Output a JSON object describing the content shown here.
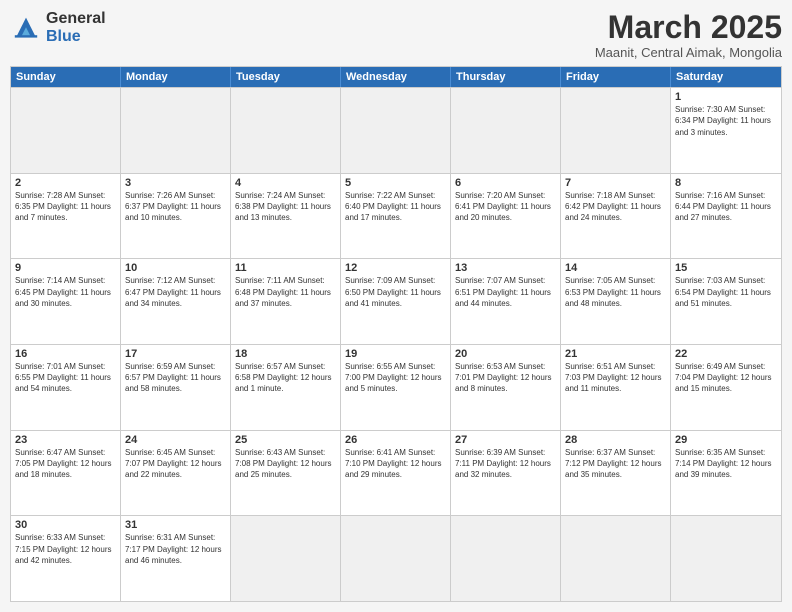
{
  "header": {
    "logo_general": "General",
    "logo_blue": "Blue",
    "month_title": "March 2025",
    "subtitle": "Maanit, Central Aimak, Mongolia"
  },
  "days_of_week": [
    "Sunday",
    "Monday",
    "Tuesday",
    "Wednesday",
    "Thursday",
    "Friday",
    "Saturday"
  ],
  "rows": [
    [
      {
        "day": "",
        "info": "",
        "empty": true
      },
      {
        "day": "",
        "info": "",
        "empty": true
      },
      {
        "day": "",
        "info": "",
        "empty": true
      },
      {
        "day": "",
        "info": "",
        "empty": true
      },
      {
        "day": "",
        "info": "",
        "empty": true
      },
      {
        "day": "",
        "info": "",
        "empty": true
      },
      {
        "day": "1",
        "info": "Sunrise: 7:30 AM\nSunset: 6:34 PM\nDaylight: 11 hours\nand 3 minutes.",
        "empty": false
      }
    ],
    [
      {
        "day": "2",
        "info": "Sunrise: 7:28 AM\nSunset: 6:35 PM\nDaylight: 11 hours\nand 7 minutes.",
        "empty": false
      },
      {
        "day": "3",
        "info": "Sunrise: 7:26 AM\nSunset: 6:37 PM\nDaylight: 11 hours\nand 10 minutes.",
        "empty": false
      },
      {
        "day": "4",
        "info": "Sunrise: 7:24 AM\nSunset: 6:38 PM\nDaylight: 11 hours\nand 13 minutes.",
        "empty": false
      },
      {
        "day": "5",
        "info": "Sunrise: 7:22 AM\nSunset: 6:40 PM\nDaylight: 11 hours\nand 17 minutes.",
        "empty": false
      },
      {
        "day": "6",
        "info": "Sunrise: 7:20 AM\nSunset: 6:41 PM\nDaylight: 11 hours\nand 20 minutes.",
        "empty": false
      },
      {
        "day": "7",
        "info": "Sunrise: 7:18 AM\nSunset: 6:42 PM\nDaylight: 11 hours\nand 24 minutes.",
        "empty": false
      },
      {
        "day": "8",
        "info": "Sunrise: 7:16 AM\nSunset: 6:44 PM\nDaylight: 11 hours\nand 27 minutes.",
        "empty": false
      }
    ],
    [
      {
        "day": "9",
        "info": "Sunrise: 7:14 AM\nSunset: 6:45 PM\nDaylight: 11 hours\nand 30 minutes.",
        "empty": false
      },
      {
        "day": "10",
        "info": "Sunrise: 7:12 AM\nSunset: 6:47 PM\nDaylight: 11 hours\nand 34 minutes.",
        "empty": false
      },
      {
        "day": "11",
        "info": "Sunrise: 7:11 AM\nSunset: 6:48 PM\nDaylight: 11 hours\nand 37 minutes.",
        "empty": false
      },
      {
        "day": "12",
        "info": "Sunrise: 7:09 AM\nSunset: 6:50 PM\nDaylight: 11 hours\nand 41 minutes.",
        "empty": false
      },
      {
        "day": "13",
        "info": "Sunrise: 7:07 AM\nSunset: 6:51 PM\nDaylight: 11 hours\nand 44 minutes.",
        "empty": false
      },
      {
        "day": "14",
        "info": "Sunrise: 7:05 AM\nSunset: 6:53 PM\nDaylight: 11 hours\nand 48 minutes.",
        "empty": false
      },
      {
        "day": "15",
        "info": "Sunrise: 7:03 AM\nSunset: 6:54 PM\nDaylight: 11 hours\nand 51 minutes.",
        "empty": false
      }
    ],
    [
      {
        "day": "16",
        "info": "Sunrise: 7:01 AM\nSunset: 6:55 PM\nDaylight: 11 hours\nand 54 minutes.",
        "empty": false
      },
      {
        "day": "17",
        "info": "Sunrise: 6:59 AM\nSunset: 6:57 PM\nDaylight: 11 hours\nand 58 minutes.",
        "empty": false
      },
      {
        "day": "18",
        "info": "Sunrise: 6:57 AM\nSunset: 6:58 PM\nDaylight: 12 hours\nand 1 minute.",
        "empty": false
      },
      {
        "day": "19",
        "info": "Sunrise: 6:55 AM\nSunset: 7:00 PM\nDaylight: 12 hours\nand 5 minutes.",
        "empty": false
      },
      {
        "day": "20",
        "info": "Sunrise: 6:53 AM\nSunset: 7:01 PM\nDaylight: 12 hours\nand 8 minutes.",
        "empty": false
      },
      {
        "day": "21",
        "info": "Sunrise: 6:51 AM\nSunset: 7:03 PM\nDaylight: 12 hours\nand 11 minutes.",
        "empty": false
      },
      {
        "day": "22",
        "info": "Sunrise: 6:49 AM\nSunset: 7:04 PM\nDaylight: 12 hours\nand 15 minutes.",
        "empty": false
      }
    ],
    [
      {
        "day": "23",
        "info": "Sunrise: 6:47 AM\nSunset: 7:05 PM\nDaylight: 12 hours\nand 18 minutes.",
        "empty": false
      },
      {
        "day": "24",
        "info": "Sunrise: 6:45 AM\nSunset: 7:07 PM\nDaylight: 12 hours\nand 22 minutes.",
        "empty": false
      },
      {
        "day": "25",
        "info": "Sunrise: 6:43 AM\nSunset: 7:08 PM\nDaylight: 12 hours\nand 25 minutes.",
        "empty": false
      },
      {
        "day": "26",
        "info": "Sunrise: 6:41 AM\nSunset: 7:10 PM\nDaylight: 12 hours\nand 29 minutes.",
        "empty": false
      },
      {
        "day": "27",
        "info": "Sunrise: 6:39 AM\nSunset: 7:11 PM\nDaylight: 12 hours\nand 32 minutes.",
        "empty": false
      },
      {
        "day": "28",
        "info": "Sunrise: 6:37 AM\nSunset: 7:12 PM\nDaylight: 12 hours\nand 35 minutes.",
        "empty": false
      },
      {
        "day": "29",
        "info": "Sunrise: 6:35 AM\nSunset: 7:14 PM\nDaylight: 12 hours\nand 39 minutes.",
        "empty": false
      }
    ],
    [
      {
        "day": "30",
        "info": "Sunrise: 6:33 AM\nSunset: 7:15 PM\nDaylight: 12 hours\nand 42 minutes.",
        "empty": false
      },
      {
        "day": "31",
        "info": "Sunrise: 6:31 AM\nSunset: 7:17 PM\nDaylight: 12 hours\nand 46 minutes.",
        "empty": false
      },
      {
        "day": "",
        "info": "",
        "empty": true
      },
      {
        "day": "",
        "info": "",
        "empty": true
      },
      {
        "day": "",
        "info": "",
        "empty": true
      },
      {
        "day": "",
        "info": "",
        "empty": true
      },
      {
        "day": "",
        "info": "",
        "empty": true
      }
    ]
  ]
}
